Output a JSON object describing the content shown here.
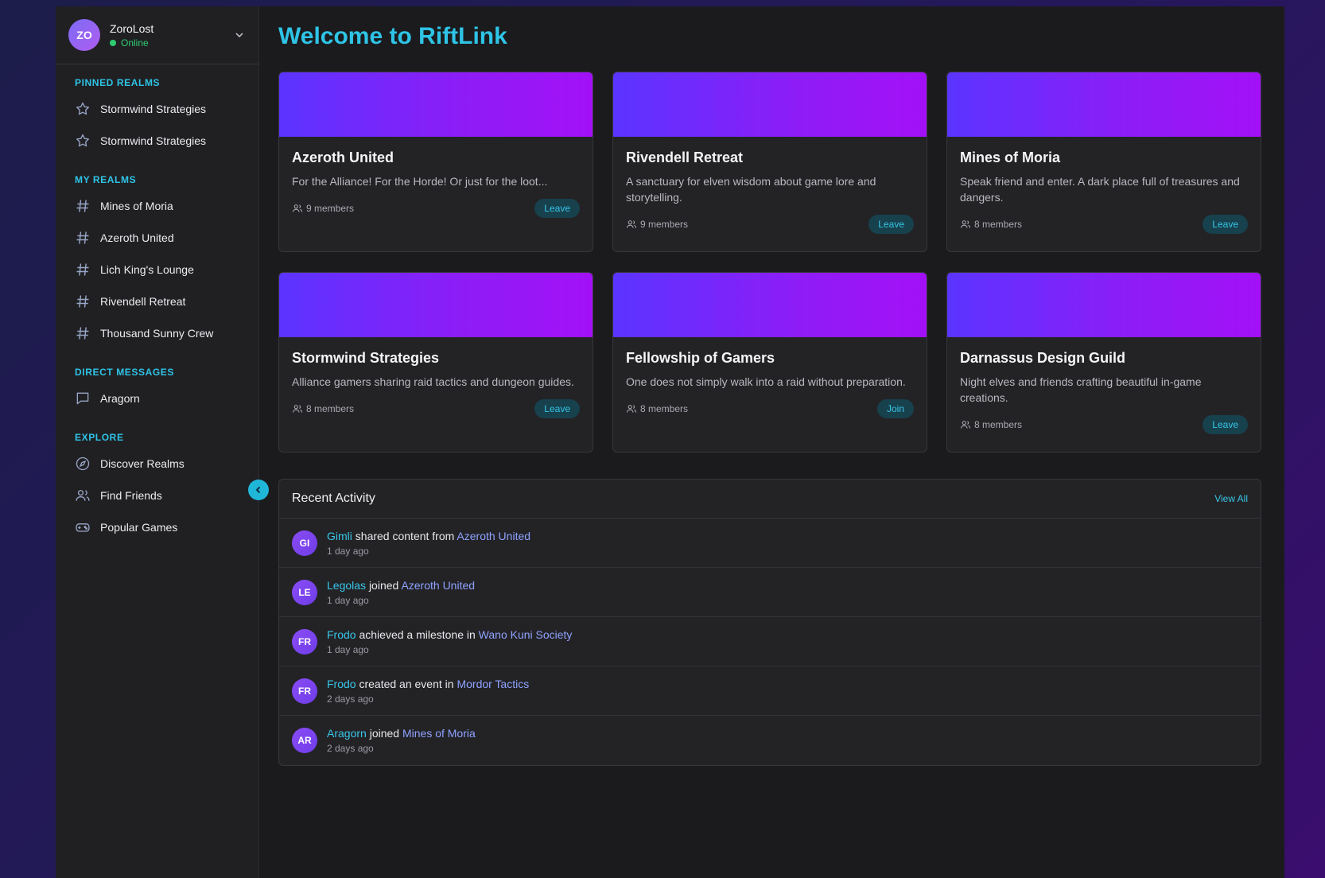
{
  "user": {
    "initials": "ZO",
    "name": "ZoroLost",
    "status": "Online"
  },
  "sidebar": {
    "sections": [
      {
        "title": "PINNED REALMS",
        "items": [
          {
            "icon": "star-icon",
            "label": "Stormwind Strategies"
          },
          {
            "icon": "star-icon",
            "label": "Stormwind Strategies"
          }
        ]
      },
      {
        "title": "MY REALMS",
        "items": [
          {
            "icon": "hash-icon",
            "label": "Mines of Moria"
          },
          {
            "icon": "hash-icon",
            "label": "Azeroth United"
          },
          {
            "icon": "hash-icon",
            "label": "Lich King's Lounge"
          },
          {
            "icon": "hash-icon",
            "label": "Rivendell Retreat"
          },
          {
            "icon": "hash-icon",
            "label": "Thousand Sunny Crew"
          }
        ]
      },
      {
        "title": "DIRECT MESSAGES",
        "items": [
          {
            "icon": "message-icon",
            "label": "Aragorn"
          }
        ]
      },
      {
        "title": "EXPLORE",
        "items": [
          {
            "icon": "compass-icon",
            "label": "Discover Realms"
          },
          {
            "icon": "users-icon",
            "label": "Find Friends"
          },
          {
            "icon": "gamepad-icon",
            "label": "Popular Games"
          }
        ]
      }
    ]
  },
  "main": {
    "title": "Welcome to RiftLink"
  },
  "realms": [
    {
      "name": "Azeroth United",
      "desc": "For the Alliance! For the Horde! Or just for the loot...",
      "members": "9 members",
      "action": "Leave"
    },
    {
      "name": "Rivendell Retreat",
      "desc": "A sanctuary for elven wisdom about game lore and storytelling.",
      "members": "9 members",
      "action": "Leave"
    },
    {
      "name": "Mines of Moria",
      "desc": "Speak friend and enter. A dark place full of treasures and dangers.",
      "members": "8 members",
      "action": "Leave"
    },
    {
      "name": "Stormwind Strategies",
      "desc": "Alliance gamers sharing raid tactics and dungeon guides.",
      "members": "8 members",
      "action": "Leave"
    },
    {
      "name": "Fellowship of Gamers",
      "desc": "One does not simply walk into a raid without preparation.",
      "members": "8 members",
      "action": "Join"
    },
    {
      "name": "Darnassus Design Guild",
      "desc": "Night elves and friends crafting beautiful in-game creations.",
      "members": "8 members",
      "action": "Leave"
    }
  ],
  "activity": {
    "title": "Recent Activity",
    "view_all": "View All",
    "items": [
      {
        "initials": "GI",
        "user": "Gimli",
        "action": "shared content from",
        "target": "Azeroth United",
        "time": "1 day ago"
      },
      {
        "initials": "LE",
        "user": "Legolas",
        "action": "joined",
        "target": "Azeroth United",
        "time": "1 day ago"
      },
      {
        "initials": "FR",
        "user": "Frodo",
        "action": "achieved a milestone in",
        "target": "Wano Kuni Society",
        "time": "1 day ago"
      },
      {
        "initials": "FR",
        "user": "Frodo",
        "action": "created an event in",
        "target": "Mordor Tactics",
        "time": "2 days ago"
      },
      {
        "initials": "AR",
        "user": "Aragorn",
        "action": "joined",
        "target": "Mines of Moria",
        "time": "2 days ago"
      }
    ]
  },
  "colors": {
    "accent": "#2ec4e6",
    "link": "#8fa2ff",
    "online": "#2ecc71",
    "banner_start": "#5b34ff",
    "banner_end": "#a310f7"
  }
}
